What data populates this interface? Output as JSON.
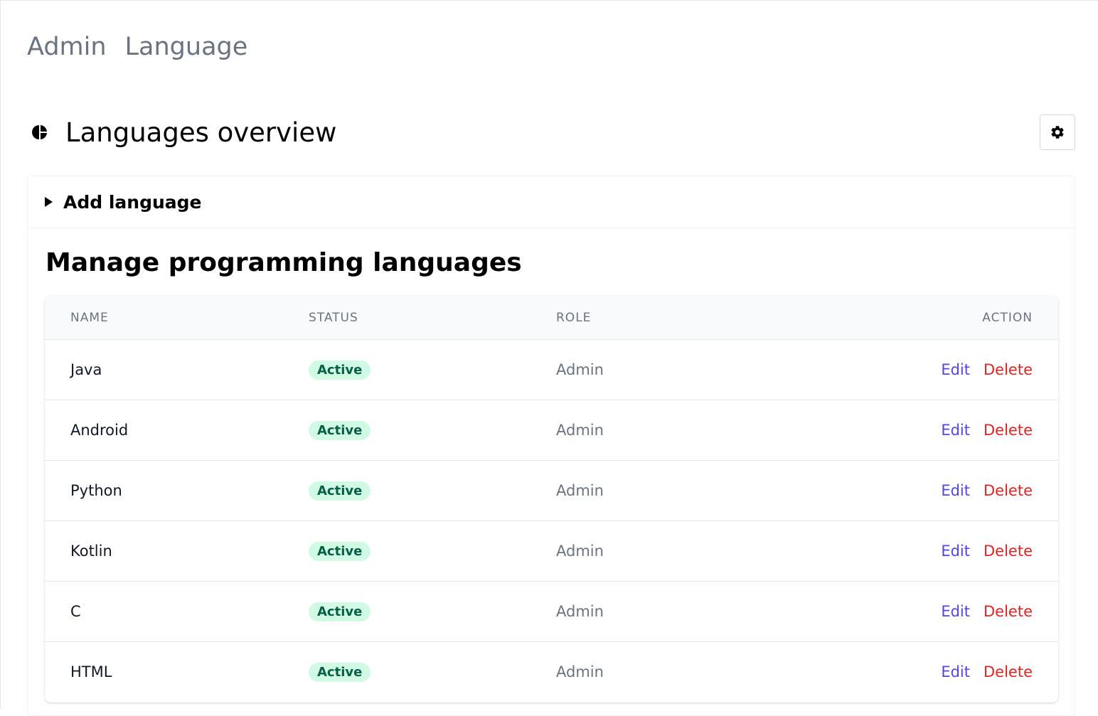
{
  "breadcrumb": [
    "Admin",
    "Language"
  ],
  "header": {
    "title": "Languages overview",
    "icon": "pie-chart-icon",
    "settings_icon": "gear-icon"
  },
  "add_language": {
    "label": "Add language"
  },
  "manage": {
    "title": "Manage programming languages",
    "columns": {
      "name": "NAME",
      "status": "STATUS",
      "role": "ROLE",
      "action": "ACTION"
    },
    "rows": [
      {
        "name": "Java",
        "status": "Active",
        "role": "Admin",
        "edit": "Edit",
        "delete": "Delete"
      },
      {
        "name": "Android",
        "status": "Active",
        "role": "Admin",
        "edit": "Edit",
        "delete": "Delete"
      },
      {
        "name": "Python",
        "status": "Active",
        "role": "Admin",
        "edit": "Edit",
        "delete": "Delete"
      },
      {
        "name": "Kotlin",
        "status": "Active",
        "role": "Admin",
        "edit": "Edit",
        "delete": "Delete"
      },
      {
        "name": "C",
        "status": "Active",
        "role": "Admin",
        "edit": "Edit",
        "delete": "Delete"
      },
      {
        "name": "HTML",
        "status": "Active",
        "role": "Admin",
        "edit": "Edit",
        "delete": "Delete"
      }
    ]
  },
  "colors": {
    "edit": "#4f46e5",
    "delete": "#dc2626",
    "badge_bg": "#d1fae5",
    "badge_text": "#065f46",
    "muted": "#6b7280"
  }
}
